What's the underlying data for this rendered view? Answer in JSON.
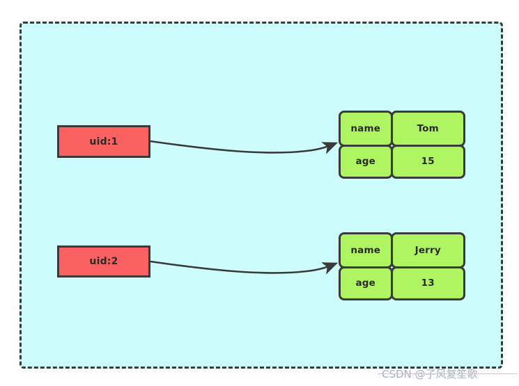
{
  "diagram": {
    "title": "redis-hash-structure-diagram",
    "background_color": "#ffffff",
    "region": {
      "fill_color": "#ccfcfc",
      "border_color": "#3a3a3a",
      "border_style": "dashed"
    },
    "key_nodes": [
      {
        "label": "uid:1",
        "fill_color": "#fc6161"
      },
      {
        "label": "uid:2",
        "fill_color": "#fc6161"
      }
    ],
    "hash_tables": [
      {
        "fill_color": "#aef561",
        "rows": [
          {
            "field": "name",
            "value": "Tom"
          },
          {
            "field": "age",
            "value": "15"
          }
        ]
      },
      {
        "fill_color": "#aef561",
        "rows": [
          {
            "field": "name",
            "value": "Jerry"
          },
          {
            "field": "age",
            "value": "13"
          }
        ]
      }
    ],
    "connectors": [
      {
        "name": "arrow-uid1-to-table1",
        "color": "#3a3a3a"
      },
      {
        "name": "arrow-uid2-to-table2",
        "color": "#3a3a3a"
      }
    ]
  },
  "watermark": {
    "text": "CSDN @子风复笙歌"
  }
}
